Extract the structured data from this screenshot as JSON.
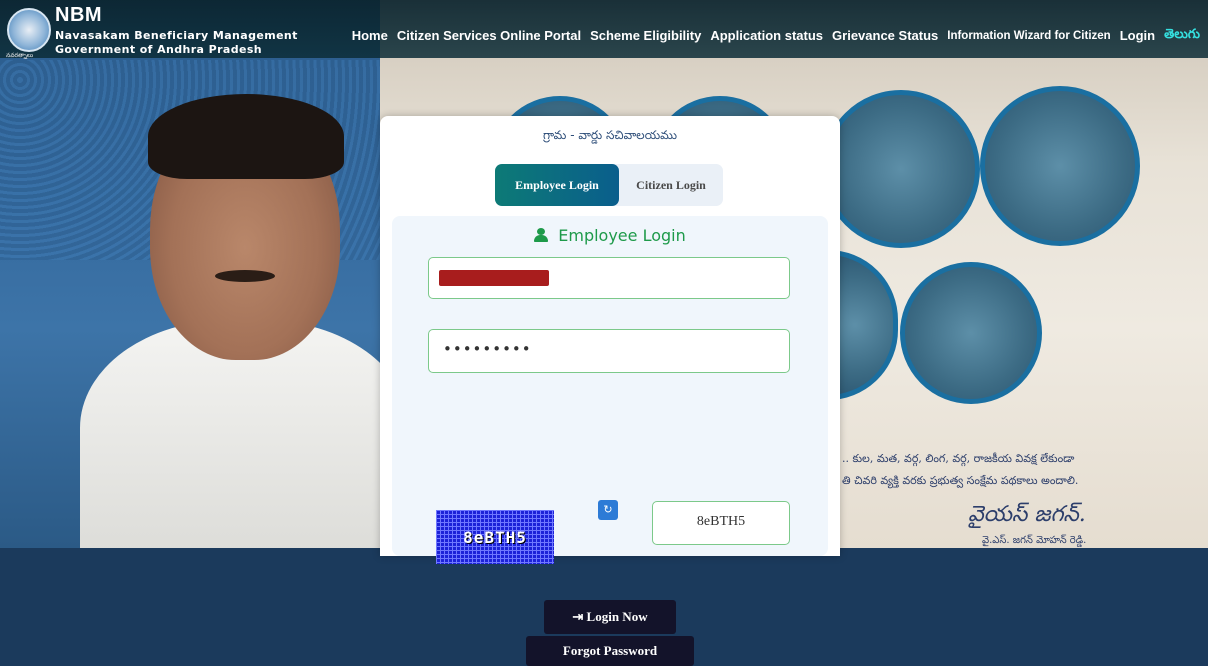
{
  "header": {
    "logo_subtext": "నవరత్నాలు",
    "title": "NBM",
    "subtitle": "Navasakam Beneficiary Management",
    "org": "Government of Andhra Pradesh",
    "nav": [
      {
        "label": "Home"
      },
      {
        "label": "Citizen Services Online Portal"
      },
      {
        "label": "Scheme Eligibility"
      },
      {
        "label": "Application status"
      },
      {
        "label": "Grievance Status"
      },
      {
        "label": "Information Wizard for Citizen"
      },
      {
        "label": "Login"
      },
      {
        "label": "తెలుగు"
      }
    ]
  },
  "card": {
    "title": "గ్రామ - వార్డు సచివాలయము",
    "tabs": [
      {
        "label": "Employee Login",
        "active": true
      },
      {
        "label": "Citizen Login",
        "active": false
      }
    ],
    "panel_title": "Employee Login",
    "username_value": "[redacted]",
    "password_value": "•••••••••",
    "captcha_image_text": "8eBTH5",
    "captcha_input_value": "8eBTH5",
    "refresh_icon": "refresh-icon",
    "login_button": "Login Now",
    "login_icon": "sign-in-icon",
    "forgot_button": "Forgot Password"
  },
  "background": {
    "telugu_line_1": ".. కుల, మత, వర్గ, లింగ, వర్గ, రాజకీయ వివక్ష లేకుండా",
    "telugu_line_2": "తి చివరి వ్యక్తి వరకు ప్రభుత్వ సంక్షేమ పథకాలు అందాలి.",
    "signature": "వైయస్ జగన్.",
    "signature_name": "వై.ఎస్. జగన్ మోహన్ రెడ్డి."
  },
  "colors": {
    "accent_tab": "#0d7a76",
    "panel_heading": "#1e9a4a",
    "telugu_link": "#35e0e0",
    "button_bg": "#13132a"
  }
}
